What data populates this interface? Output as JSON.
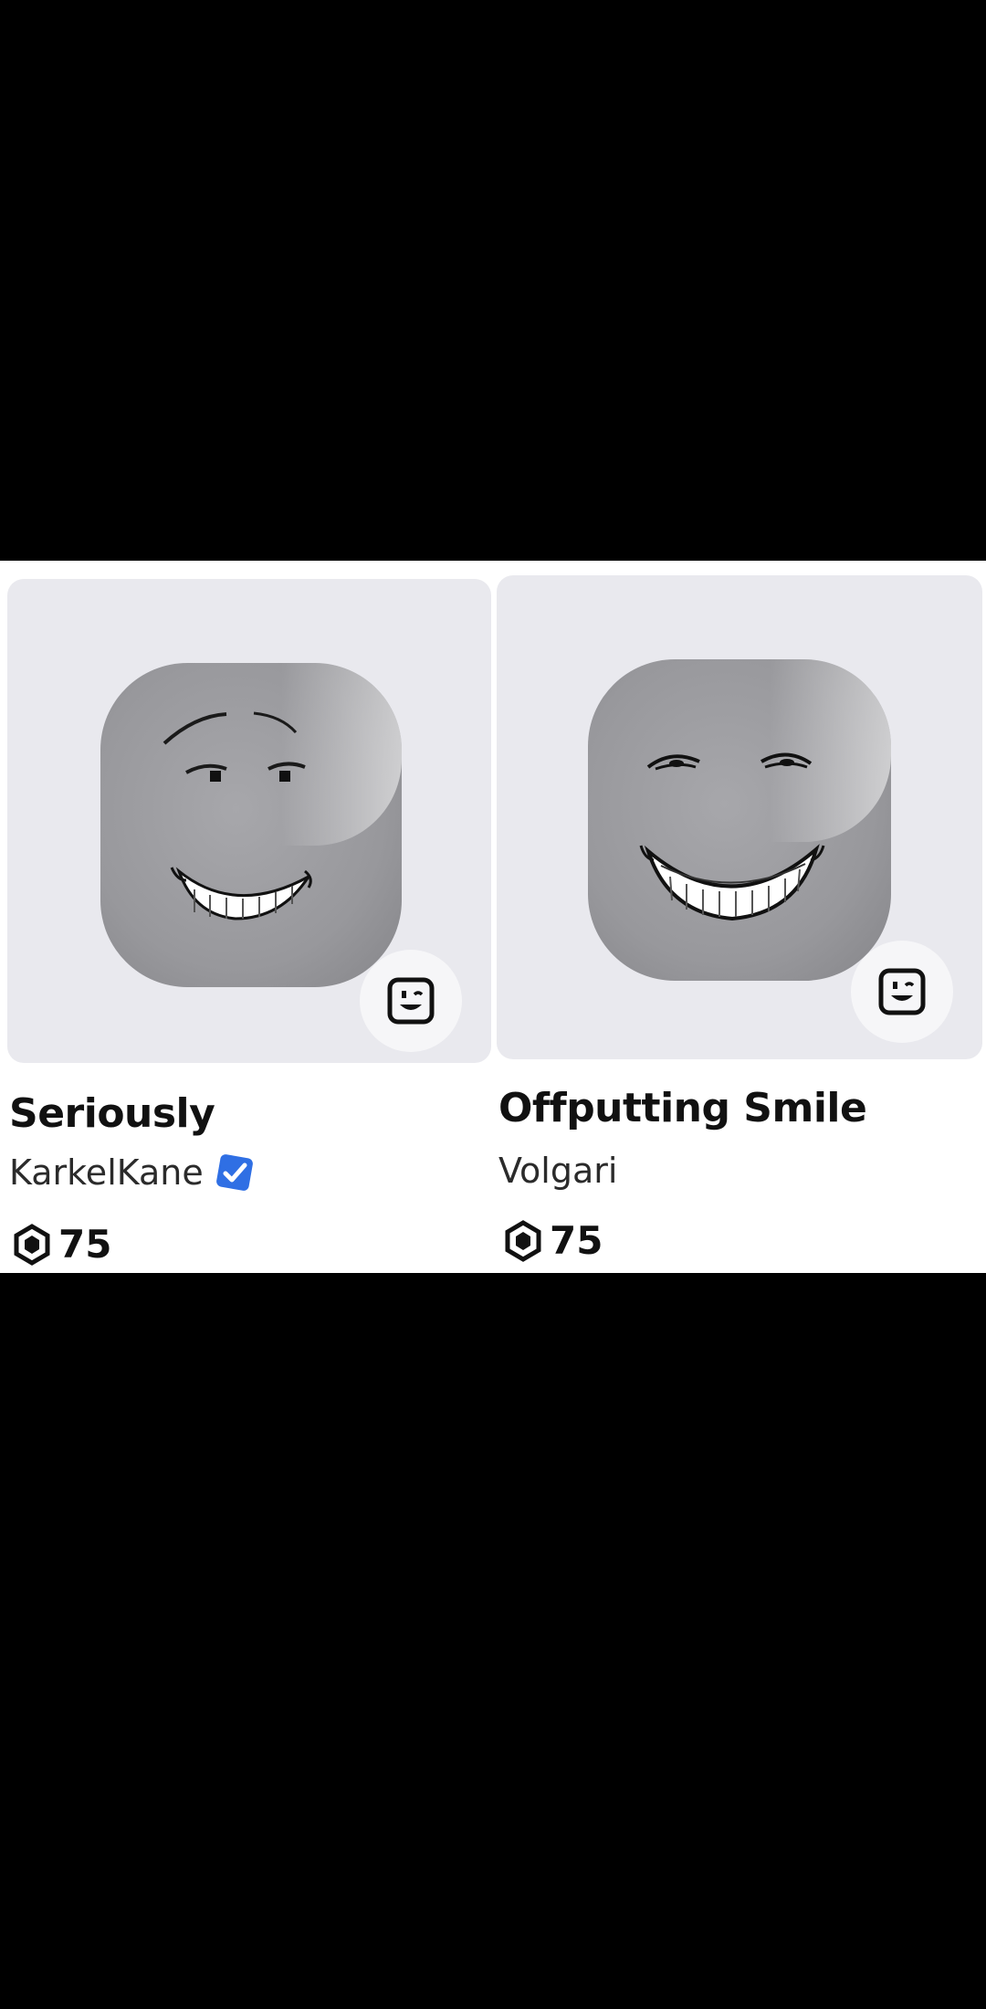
{
  "catalog": {
    "items": [
      {
        "name": "Seriously",
        "creator": "KarkelKane",
        "creator_verified": true,
        "price": "75",
        "currency_icon": "robux-icon",
        "type_badge_icon": "face-accessory-icon"
      },
      {
        "name": "Offputting Smile",
        "creator": "Volgari",
        "creator_verified": false,
        "price": "75",
        "currency_icon": "robux-icon",
        "type_badge_icon": "face-accessory-icon"
      }
    ]
  },
  "colors": {
    "background": "#000000",
    "card_background": "#ffffff",
    "thumbnail_background": "#e9e9ee",
    "verified_blue": "#2f6fe4",
    "text_primary": "#111111"
  }
}
